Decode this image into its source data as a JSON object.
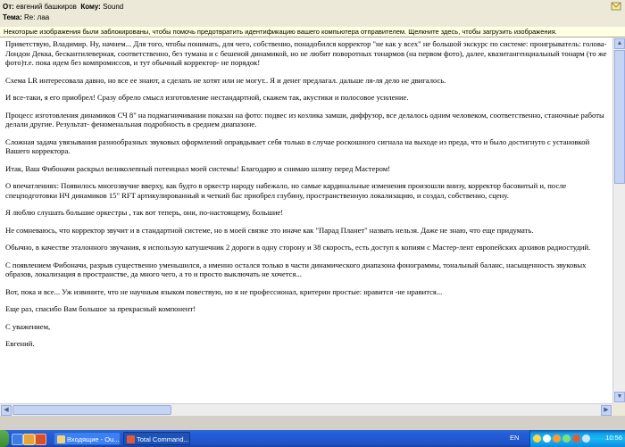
{
  "header": {
    "from_label": "От:",
    "from_value": "евгений башкиров",
    "to_label": "Кому:",
    "to_value": "Sound",
    "subject_label": "Тема:",
    "subject_value": "Re: лаа"
  },
  "infobar": {
    "text": "Некоторые изображения были заблокированы, чтобы помочь предотвратить идентификацию вашего компьютера отправителем. Щелкните здесь, чтобы загрузить изображения."
  },
  "message": {
    "paragraphs": [
      "  Приветствую, Владимир. Ну, начнем... Для того, чтобы понимать, для чего, собственно, понадобился корректор \"не как у всех\" не большой экскурс по системе: проигрыватель: голова-Лондон Декка, бескантилеверная,   соответственно, без тумана и с бешеной динамикой, но не любит поворотных тонармов (на первом фото), далее, квазитангенциальный тонарм (то же фото)т.е. пока идем без компромиссов, и тут обычный корректор- не порядок!",
      "Схема LR  интересовала давно, но все ее знают, а сделать не хотят или не могут.. Я и денег предлагал. дальше ля-ля дело не двигалось.",
      "И все-таки, я его приобрел! Сразу обрело смысл изготовление нестандартной, скажем так, акустики и полосовое усиление.",
      "Процесс изготовления динамиков СЧ 8\" на подмагничивании показан на фото: подвес из козлика замши, диффузор, все делалось одним человеком, соответственно, станочные работы делали другие. Результат- феноменальная подробность в среднем диапазоне.",
      "Сложная задача увязывания разнообразных звуковых оформлений оправдывает себя только в случае роскошного сигнала на выходе из преда, что и было достигнуто с установкой Вашего корректора.",
      "Итак, Ваш Фибоначи раскрыл великолепный потенциал моей системы! Благодарю и снимаю шляпу перед Мастером!",
      "О впечатлениях: Появилось многозвучие вверху, как будто в оркестр народу набежало, но самые кардинальные изменения произошли внизу, корректор басовитый и, после спецподготовки НЧ динамиков 15\" RFT артикулированный и четкий бас приобрел глубину, пространственную локализацию, и создал, собственно, сцену.",
      "Я люблю слушать большие оркестры , так вот теперь, они, по-настоящему, большие!",
      "Не сомневаюсь, что корректор звучит и в стандартной системе, но в моей связке это иначе как \"Парад Планет\" назвать нельзя. Даже не знаю, что еще придумать.",
      "Обычно, в качестве эталонного звучания, я использую катушечник 2 дороги в одну сторону и 38 скорость, есть доступ к копиям с Мастер-лент европейских архивов радиостудий.",
      "С появлением Фибоначи, разрыв существенно уменьшился, а именно остался только в части динамического диапазона фонограммы, тональный баланс, насыщенность звуковых образов, локализация в пространстве, да много чего, а то и просто выключать не хочется...",
      " Вот, пока и все... Уж извините, что не научным языком повествую, но я не профессионал, критерии простые: нравится -не нравится...",
      "Еще раз, спасибо Вам большое за прекрасный компонент!",
      "С уважением,",
      "Евгений."
    ]
  },
  "taskbar": {
    "btn1_label": "Входящие - Ou...",
    "btn2_label": "Total Command...",
    "lang": "EN",
    "clock": "10:56"
  },
  "colors": {
    "taskbar": "#245edb",
    "tray": "#18b9f1",
    "infobar": "#ffffe1"
  }
}
